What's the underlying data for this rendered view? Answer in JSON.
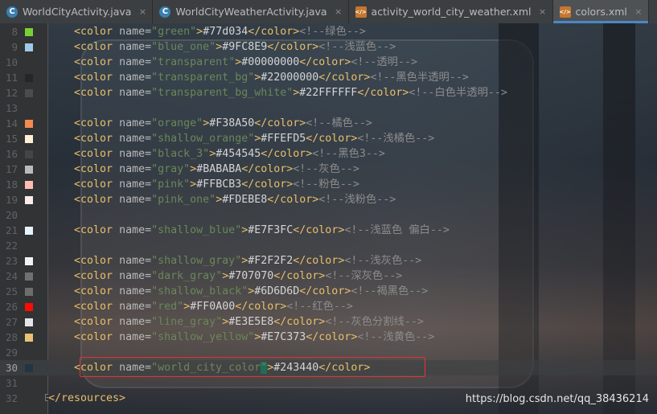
{
  "tabs": [
    {
      "label": "WorldCityActivity.java",
      "icon": "java-class-icon",
      "active": false
    },
    {
      "label": "WorldCityWeatherActivity.java",
      "icon": "java-class-icon",
      "active": false
    },
    {
      "label": "activity_world_city_weather.xml",
      "icon": "xml-file-icon",
      "active": false
    },
    {
      "label": "colors.xml",
      "icon": "xml-file-icon",
      "active": true
    }
  ],
  "tab_close_glyph": "×",
  "watermark": "https://blog.csdn.net/qq_38436214",
  "colors": {
    "tag": "#e8bf6a",
    "attribute_value": "#6a8759",
    "comment": "#8c8c8c",
    "highlight_border": "#e03535"
  },
  "lines": [
    {
      "num": "8",
      "kind": "color",
      "name": "green",
      "value": "#77d034",
      "comment": "<!--绿色-->",
      "swatch": "#77d034"
    },
    {
      "num": "9",
      "kind": "color",
      "name": "blue_one",
      "value": "#9FC8E9",
      "comment": "<!--浅蓝色-->",
      "swatch": "#9FC8E9"
    },
    {
      "num": "10",
      "kind": "color",
      "name": "transparent",
      "value": "#00000000",
      "comment": "<!--透明-->",
      "swatch": ""
    },
    {
      "num": "11",
      "kind": "color",
      "name": "transparent_bg",
      "value": "#22000000",
      "comment": "<!--黑色半透明-->",
      "swatch": "#262626"
    },
    {
      "num": "12",
      "kind": "color",
      "name": "transparent_bg_white",
      "value": "#22FFFFFF",
      "comment": "<!--白色半透明-->",
      "swatch": "#4a4c4e"
    },
    {
      "num": "13",
      "kind": "blank"
    },
    {
      "num": "14",
      "kind": "color",
      "name": "orange",
      "value": "#F38A50",
      "comment": "<!--橘色-->",
      "swatch": "#F38A50"
    },
    {
      "num": "15",
      "kind": "color",
      "name": "shallow_orange",
      "value": "#FFEFD5",
      "comment": "<!--浅橘色-->",
      "swatch": "#FFEFD5"
    },
    {
      "num": "16",
      "kind": "color",
      "name": "black_3",
      "value": "#454545",
      "comment": "<!--黑色3-->",
      "swatch": "#454545"
    },
    {
      "num": "17",
      "kind": "color",
      "name": "gray",
      "value": "#BABABA",
      "comment": "<!--灰色-->",
      "swatch": "#BABABA"
    },
    {
      "num": "18",
      "kind": "color",
      "name": "pink",
      "value": "#FFBCB3",
      "comment": "<!--粉色-->",
      "swatch": "#FFBCB3"
    },
    {
      "num": "19",
      "kind": "color",
      "name": "pink_one",
      "value": "#FDEBE8",
      "comment": "<!--浅粉色-->",
      "swatch": "#FDEBE8"
    },
    {
      "num": "20",
      "kind": "blank"
    },
    {
      "num": "21",
      "kind": "color",
      "name": "shallow_blue",
      "value": "#E7F3FC",
      "comment": "<!--浅蓝色 偏白-->",
      "swatch": "#E7F3FC"
    },
    {
      "num": "22",
      "kind": "blank"
    },
    {
      "num": "23",
      "kind": "color",
      "name": "shallow_gray",
      "value": "#F2F2F2",
      "comment": "<!--浅灰色-->",
      "swatch": "#F2F2F2"
    },
    {
      "num": "24",
      "kind": "color",
      "name": "dark_gray",
      "value": "#707070",
      "comment": "<!--深灰色-->",
      "swatch": "#707070"
    },
    {
      "num": "25",
      "kind": "color",
      "name": "shallow_black",
      "value": "#6D6D6D",
      "comment": "<!--褐黑色-->",
      "swatch": "#6D6D6D"
    },
    {
      "num": "26",
      "kind": "color",
      "name": "red",
      "value": "#FF0A00",
      "comment": "<!--红色-->",
      "swatch": "#FF0A00"
    },
    {
      "num": "27",
      "kind": "color",
      "name": "line_gray",
      "value": "#E3E5E8",
      "comment": "<!--灰色分割线-->",
      "swatch": "#E3E5E8"
    },
    {
      "num": "28",
      "kind": "color",
      "name": "shallow_yellow",
      "value": "#E7C373",
      "comment": "<!--浅黄色-->",
      "swatch": "#E7C373"
    },
    {
      "num": "29",
      "kind": "blank"
    },
    {
      "num": "30",
      "kind": "color",
      "name": "world_city_color",
      "value": "#243440",
      "comment": "",
      "swatch": "#243440",
      "current": true,
      "highlighted": true
    },
    {
      "num": "31",
      "kind": "blank"
    },
    {
      "num": "32",
      "kind": "close",
      "text": "</resources>"
    }
  ]
}
